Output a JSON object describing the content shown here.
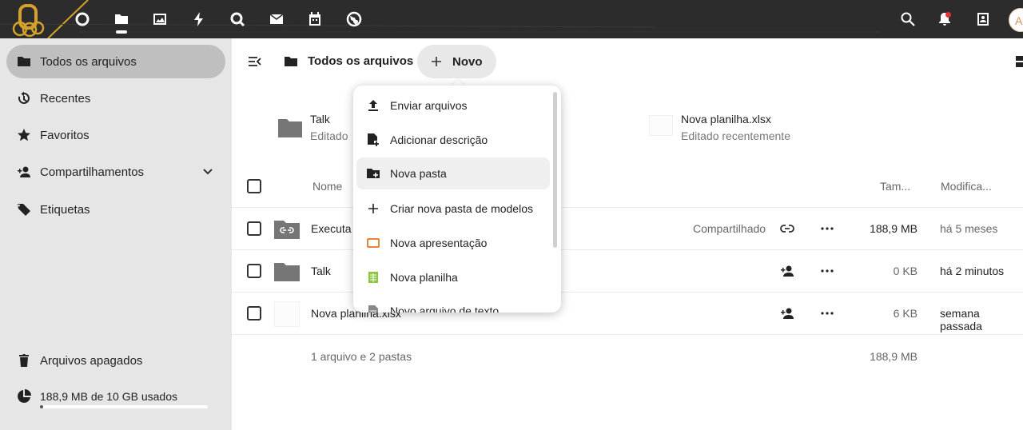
{
  "topbar": {
    "apps": [
      {
        "icon": "dashboard-circle-icon"
      },
      {
        "icon": "files-folder-icon"
      },
      {
        "icon": "photos-icon"
      },
      {
        "icon": "activity-bolt-icon"
      },
      {
        "icon": "talk-search-bubble-icon"
      },
      {
        "icon": "mail-icon"
      },
      {
        "icon": "calendar-icon"
      },
      {
        "icon": "globe-icon"
      }
    ],
    "avatar_initial": "A"
  },
  "sidebar": {
    "items": [
      {
        "label": "Todos os arquivos",
        "icon": "folder-icon",
        "active": true
      },
      {
        "label": "Recentes",
        "icon": "history-icon"
      },
      {
        "label": "Favoritos",
        "icon": "star-icon"
      },
      {
        "label": "Compartilhamentos",
        "icon": "share-user-icon"
      },
      {
        "label": "Etiquetas",
        "icon": "tag-icon"
      }
    ],
    "trash_label": "Arquivos apagados",
    "storage_label": "188,9 MB de 10 GB usados",
    "storage_fraction": 0.02
  },
  "header": {
    "breadcrumb": "Todos os arquivos",
    "new_button": "Novo"
  },
  "recent": [
    {
      "name": "Talk",
      "sub": "Editado"
    },
    {
      "name": "Nova planilha.xlsx",
      "sub": "Editado recentemente"
    }
  ],
  "table": {
    "columns": {
      "name": "Nome",
      "size": "Tam...",
      "modified": "Modifica..."
    },
    "rows": [
      {
        "name": "Executa",
        "shared": "Compartilhado",
        "size": "188,9 MB",
        "modified": "há 5 meses"
      },
      {
        "name": "Talk",
        "shared": "",
        "size": "0 KB",
        "modified": "há 2 minutos"
      },
      {
        "name": "Nova planilha.xlsx",
        "shared": "",
        "size": "6 KB",
        "modified": "semana passada"
      }
    ],
    "summary": "1 arquivo e 2 pastas",
    "summary_size": "188,9 MB"
  },
  "menu": {
    "items": [
      {
        "label": "Enviar arquivos",
        "icon": "upload-icon"
      },
      {
        "label": "Adicionar descrição",
        "icon": "file-plus-icon"
      },
      {
        "label": "Nova pasta",
        "icon": "folder-plus-icon"
      },
      {
        "label": "Criar nova pasta de modelos",
        "icon": "plus-icon"
      },
      {
        "label": "Nova apresentação",
        "icon": "presentation-icon"
      },
      {
        "label": "Nova planilha",
        "icon": "spreadsheet-icon"
      },
      {
        "label": "Novo arquivo de texto",
        "icon": "text-file-icon"
      }
    ]
  },
  "colors": {
    "topbar": "#2c2c2c",
    "sidebar": "#e6e6e6",
    "accent_logo": "#d4a12a",
    "presentation": "#e9853a",
    "spreadsheet": "#8cc63f"
  }
}
